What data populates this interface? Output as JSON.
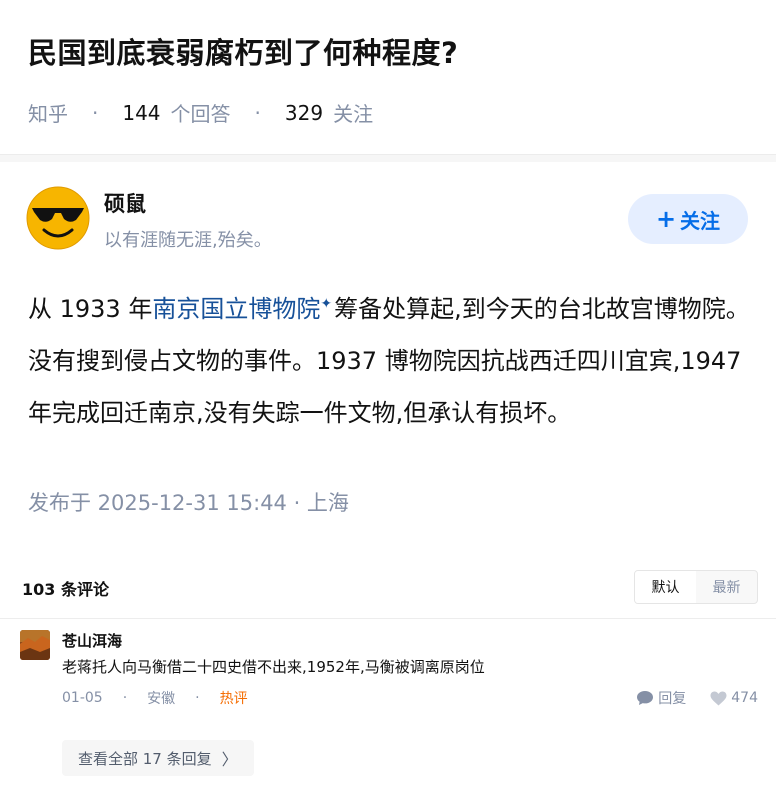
{
  "question": {
    "title": "民国到底衰弱腐朽到了何种程度?",
    "site": "知乎",
    "answer_count": "144",
    "answer_label": "个回答",
    "follow_count": "329",
    "follow_label": "关注"
  },
  "answer": {
    "author_name": "硕鼠",
    "author_bio": "以有涯随无涯,殆矣。",
    "follow_button": "关注",
    "content_part1": "从 1933 年",
    "content_link": "南京国立博物院",
    "content_part2": "筹备处算起,到今天的台北故宫博物院。没有搜到侵占文物的事件。1937 博物院因抗战西迁四川宜宾,1947 年完成回迁南京,没有失踪一件文物,但承认有损坏。",
    "published": "发布于 2025-12-31  15:44 · 上海"
  },
  "comments": {
    "count_label": "103 条评论",
    "sort_default": "默认",
    "sort_latest": "最新",
    "items": [
      {
        "name": "苍山洱海",
        "text": "老蒋托人向马衡借二十四史借不出来,1952年,马衡被调离原岗位",
        "date": "01-05",
        "location": "安徽",
        "tag": "热评",
        "reply_label": "回复",
        "likes": "474"
      }
    ],
    "view_all": "查看全部 17 条回复"
  },
  "colors": {
    "accent_blue": "#056de8",
    "link_blue": "#175199",
    "meta_gray": "#8590a6",
    "hot_orange": "#f56c00"
  }
}
